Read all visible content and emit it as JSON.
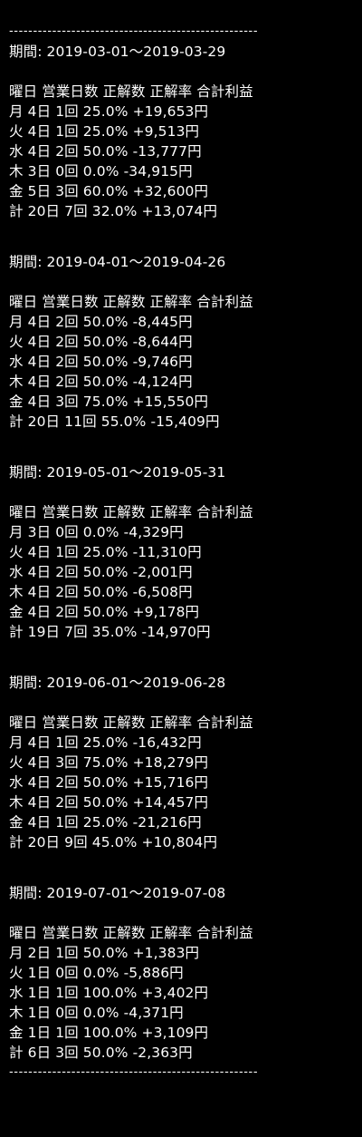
{
  "divider": "----------------------------------------------------",
  "header_row": "曜日 営業日数 正解数 正解率 合計利益",
  "periods": [
    {
      "title": "期間: 2019-03-01〜2019-03-29",
      "rows": [
        "月 4日 1回 25.0% +19,653円",
        "火 4日 1回 25.0% +9,513円",
        "水 4日 2回 50.0% -13,777円",
        "木 3日 0回 0.0% -34,915円",
        "金 5日 3回 60.0% +32,600円",
        "計 20日 7回 32.0% +13,074円"
      ]
    },
    {
      "title": "期間: 2019-04-01〜2019-04-26",
      "rows": [
        "月 4日 2回 50.0% -8,445円",
        "火 4日 2回 50.0% -8,644円",
        "水 4日 2回 50.0% -9,746円",
        "木 4日 2回 50.0% -4,124円",
        "金 4日 3回 75.0% +15,550円",
        "計 20日 11回 55.0% -15,409円"
      ]
    },
    {
      "title": "期間: 2019-05-01〜2019-05-31",
      "rows": [
        "月 3日 0回 0.0% -4,329円",
        "火 4日 1回 25.0% -11,310円",
        "水 4日 2回 50.0% -2,001円",
        "木 4日 2回 50.0% -6,508円",
        "金 4日 2回 50.0% +9,178円",
        "計 19日 7回 35.0% -14,970円"
      ]
    },
    {
      "title": "期間: 2019-06-01〜2019-06-28",
      "rows": [
        "月 4日 1回 25.0% -16,432円",
        "火 4日 3回 75.0% +18,279円",
        "水 4日 2回 50.0% +15,716円",
        "木 4日 2回 50.0% +14,457円",
        "金 4日 1回 25.0% -21,216円",
        "計 20日 9回 45.0% +10,804円"
      ]
    },
    {
      "title": "期間: 2019-07-01〜2019-07-08",
      "rows": [
        "月 2日 1回 50.0% +1,383円",
        "火 1日 0回 0.0% -5,886円",
        "水 1日 1回 100.0% +3,402円",
        "木 1日 0回 0.0% -4,371円",
        "金 1日 1回 100.0% +3,109円",
        "計 6日 3回 50.0% -2,363円"
      ]
    }
  ]
}
